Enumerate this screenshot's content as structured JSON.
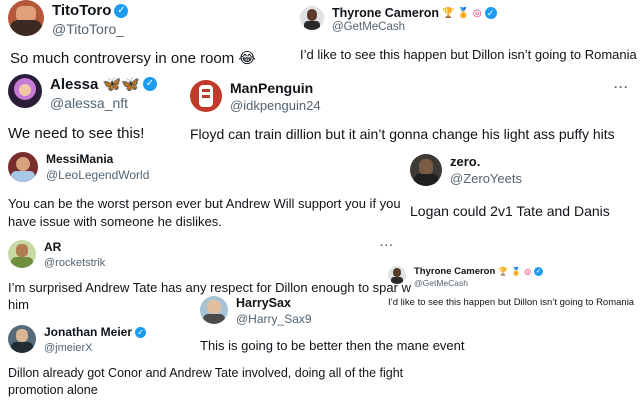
{
  "tweets": [
    {
      "name": "TitoToro",
      "handle": "@TitoToro_",
      "verified": true,
      "badges": [],
      "text": "So much controversy in one room 😂"
    },
    {
      "name": "Thyrone Cameron",
      "handle": "@GetMeCash",
      "verified": true,
      "badges": [
        "trophy-icon",
        "medal-icon",
        "target-icon"
      ],
      "text": "I’d like to see this happen but Dillon isn’t going to Romania"
    },
    {
      "name": "Alessa 🦋🦋",
      "handle": "@alessa_nft",
      "verified": true,
      "badges": [],
      "text": "We need to see this!"
    },
    {
      "name": "ManPenguin",
      "handle": "@idkpenguin24",
      "verified": false,
      "badges": [],
      "text": "Floyd can train dillion but it ain’t gonna change his light ass puffy hits"
    },
    {
      "name": "MessiMania",
      "handle": "@LeoLegendWorld",
      "verified": false,
      "badges": [],
      "text_lines": [
        "You can be the worst person ever but Andrew Will support you if you",
        "have issue with someone he dislikes."
      ]
    },
    {
      "name": "zero.",
      "handle": "@ZeroYeets",
      "verified": false,
      "badges": [],
      "text": "Logan could 2v1 Tate and Danis"
    },
    {
      "name": "AR",
      "handle": "@rocketstrik",
      "verified": false,
      "badges": [],
      "text_lines": [
        "I’m surprised Andrew Tate has any respect for Dillon enough to spar w",
        "him"
      ]
    },
    {
      "name": "Thyrone Cameron",
      "handle": "@GetMeCash",
      "verified": true,
      "badges": [
        "trophy-icon",
        "medal-icon",
        "target-icon"
      ],
      "text": "I’d like to see this happen but Dillon isn’t going to Romania"
    },
    {
      "name": "HarrySax",
      "handle": "@Harry_Sax9",
      "verified": false,
      "badges": [],
      "text": "This is going to be better then the mane event"
    },
    {
      "name": "Jonathan Meier",
      "handle": "@jmeierX",
      "verified": true,
      "badges": [],
      "text_lines": [
        "Dillon already got Conor and Andrew Tate involved, doing all of the fight",
        "promotion alone"
      ]
    }
  ],
  "more_label": "···",
  "icons": {
    "verified": "verified-check-icon",
    "more": "more-options-icon"
  },
  "colors": {
    "verified": "#1d9bf0",
    "handle": "#536471",
    "text": "#0f1419"
  }
}
